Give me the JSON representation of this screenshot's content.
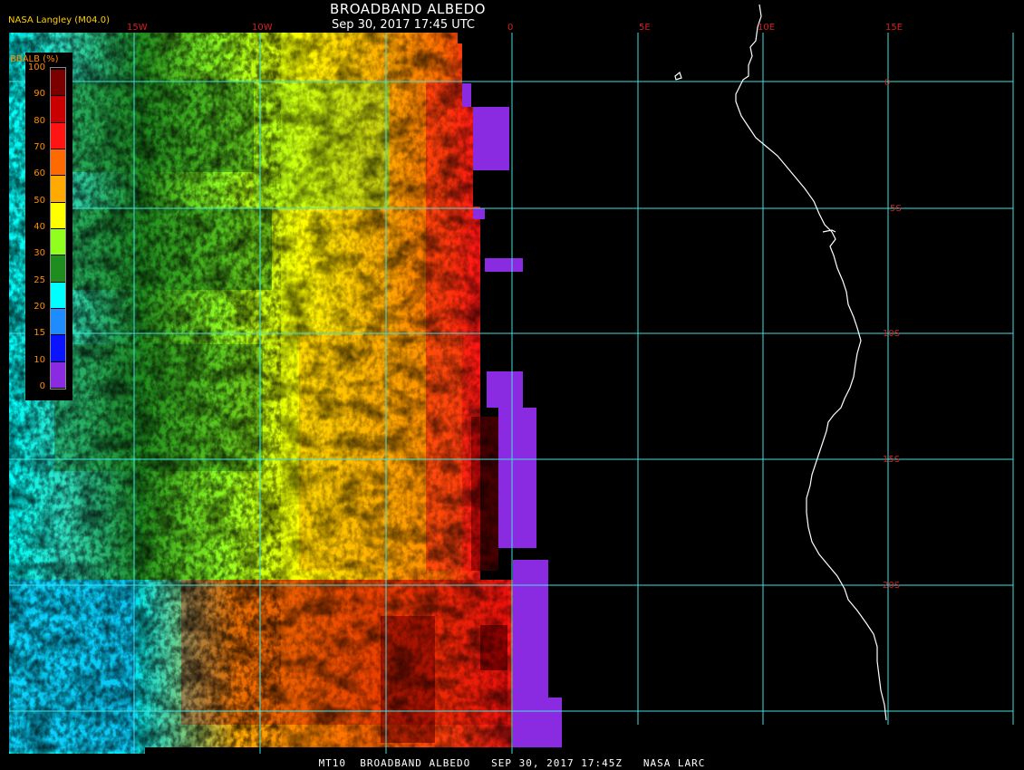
{
  "header": {
    "title": "BROADBAND ALBEDO",
    "subtitle": "Sep 30, 2017 17:45 UTC",
    "credit": "NASA Langley (M04.0)"
  },
  "footer": {
    "text": "MT10  BROADBAND ALBEDO   SEP 30, 2017 17:45Z   NASA LARC"
  },
  "legend": {
    "title": "BBALB (%)",
    "ticks": [
      "100",
      "90",
      "80",
      "70",
      "60",
      "50",
      "40",
      "30",
      "25",
      "20",
      "15",
      "10",
      "0"
    ],
    "bins": [
      {
        "color": "#7a0000"
      },
      {
        "color": "#c80000"
      },
      {
        "color": "#ff1414"
      },
      {
        "color": "#ff6a00"
      },
      {
        "color": "#ffaa00"
      },
      {
        "color": "#ffff00"
      },
      {
        "color": "#90ff20"
      },
      {
        "color": "#1f8c1f"
      },
      {
        "color": "#00ffff"
      },
      {
        "color": "#1e8cff"
      },
      {
        "color": "#0a14ff"
      },
      {
        "color": "#8a2be2"
      }
    ]
  },
  "grid": {
    "color": "#40e0e0",
    "longitude_labels": [
      "15W",
      "10W",
      "0",
      "5E",
      "10E",
      "15E"
    ],
    "latitude_labels": [
      "0",
      "5S",
      "10S",
      "15S",
      "20S"
    ]
  },
  "colors": {
    "background": "#000000",
    "coastline": "#ffffff",
    "axis_label": "#d42020"
  }
}
